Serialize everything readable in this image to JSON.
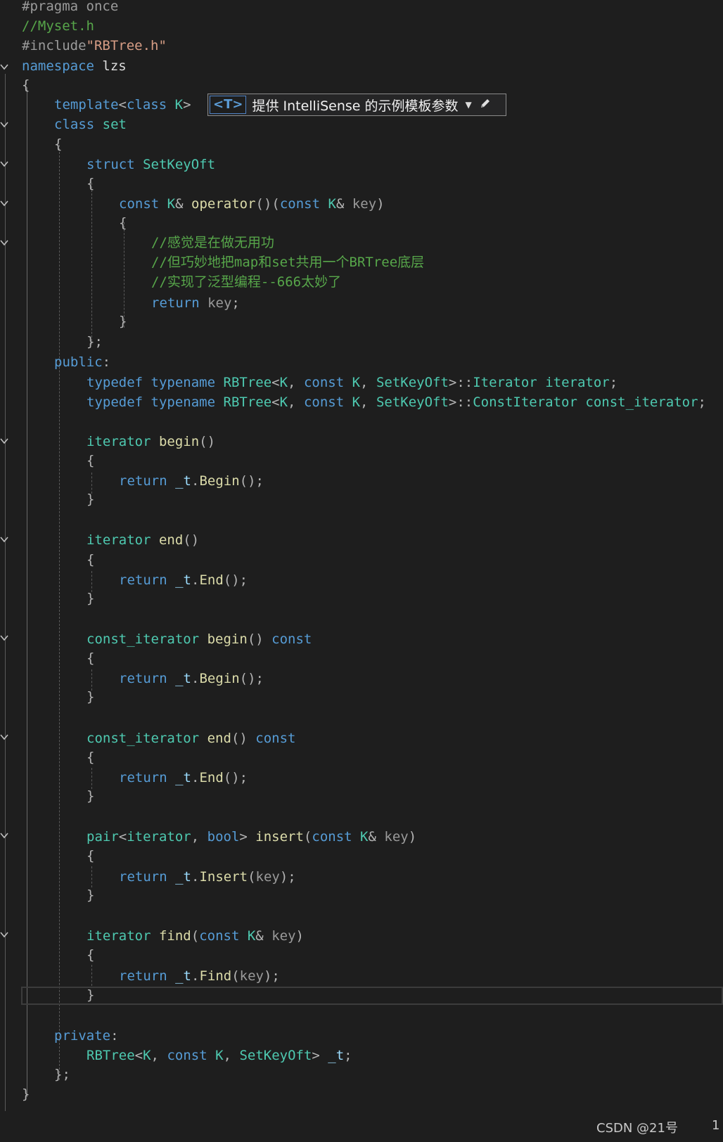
{
  "editor": {
    "lines": {
      "l1": [
        "#pragma once"
      ],
      "l2": [
        "//Myset.h"
      ],
      "l3": [
        "#include",
        "\"RBTree.h\""
      ],
      "l4": [
        "namespace",
        " lzs"
      ],
      "l5": [
        "{"
      ],
      "l6": [
        "template",
        "<",
        "class",
        " ",
        "K",
        ">"
      ],
      "l7": [
        "class",
        " ",
        "set"
      ],
      "l8": [
        "{"
      ],
      "l9": [
        "struct",
        " ",
        "SetKeyOft"
      ],
      "l10": [
        "{"
      ],
      "l11": [
        "const",
        " ",
        "K",
        "& ",
        "operator",
        "()",
        "(",
        "const",
        " ",
        "K",
        "& ",
        "key",
        ")"
      ],
      "l12": [
        "{"
      ],
      "l13": [
        "//感觉是在做无用功"
      ],
      "l14": [
        "//但巧妙地把map和set共用一个BRTree底层"
      ],
      "l15": [
        "//实现了泛型编程--666太妙了"
      ],
      "l16": [
        "return",
        " ",
        "key",
        ";"
      ],
      "l17": [
        "}"
      ],
      "l18": [
        "};"
      ],
      "l19": [
        "public",
        ":"
      ],
      "l20": [
        "typedef",
        " ",
        "typename",
        " ",
        "RBTree",
        "<",
        "K",
        ", ",
        "const",
        " ",
        "K",
        ", ",
        "SetKeyOft",
        ">::",
        "Iterator",
        " ",
        "iterator",
        ";"
      ],
      "l21": [
        "typedef",
        " ",
        "typename",
        " ",
        "RBTree",
        "<",
        "K",
        ", ",
        "const",
        " ",
        "K",
        ", ",
        "SetKeyOft",
        ">::",
        "ConstIterator",
        " ",
        "const_iterator",
        ";"
      ],
      "l23": [
        "iterator",
        " ",
        "begin",
        "()"
      ],
      "l24": [
        "{"
      ],
      "l25": [
        "return",
        " ",
        "_t",
        ".",
        "Begin",
        "();"
      ],
      "l26": [
        "}"
      ],
      "l28": [
        "iterator",
        " ",
        "end",
        "()"
      ],
      "l29": [
        "{"
      ],
      "l30": [
        "return",
        " ",
        "_t",
        ".",
        "End",
        "();"
      ],
      "l31": [
        "}"
      ],
      "l33": [
        "const_iterator",
        " ",
        "begin",
        "() ",
        "const"
      ],
      "l34": [
        "{"
      ],
      "l35": [
        "return",
        " ",
        "_t",
        ".",
        "Begin",
        "();"
      ],
      "l36": [
        "}"
      ],
      "l38": [
        "const_iterator",
        " ",
        "end",
        "() ",
        "const"
      ],
      "l39": [
        "{"
      ],
      "l40": [
        "return",
        " ",
        "_t",
        ".",
        "End",
        "();"
      ],
      "l41": [
        "}"
      ],
      "l43": [
        "pair",
        "<",
        "iterator",
        ", ",
        "bool",
        "> ",
        "insert",
        "(",
        "const",
        " ",
        "K",
        "& ",
        "key",
        ")"
      ],
      "l44": [
        "{"
      ],
      "l45": [
        "return",
        " ",
        "_t",
        ".",
        "Insert",
        "(",
        "key",
        ");"
      ],
      "l46": [
        "}"
      ],
      "l48": [
        "iterator",
        " ",
        "find",
        "(",
        "const",
        " ",
        "K",
        "& ",
        "key",
        ")"
      ],
      "l49": [
        "{"
      ],
      "l50": [
        "return",
        " ",
        "_t",
        ".",
        "Find",
        "(",
        "key",
        ");"
      ],
      "l51": [
        "}"
      ],
      "l53": [
        "private",
        ":"
      ],
      "l54": [
        "RBTree",
        "<",
        "K",
        ", ",
        "const",
        " ",
        "K",
        ", ",
        "SetKeyOft",
        "> ",
        "_t",
        ";"
      ],
      "l55": [
        "};"
      ],
      "l56": [
        "}"
      ]
    }
  },
  "intellisense": {
    "tag": "<T>",
    "text": "提供 IntelliSense 的示例模板参数",
    "dropdown_icon": "chevron-down-icon",
    "edit_icon": "pencil-icon"
  },
  "footer": {
    "watermark": "CSDN @21号",
    "line_number": "1"
  },
  "colors": {
    "background": "#1e1e1e",
    "keyword": "#569cd6",
    "type": "#4ec9b0",
    "function": "#dcdcaa",
    "comment": "#57a64a",
    "string": "#d69d85",
    "preprocessor": "#9b9b9b"
  }
}
